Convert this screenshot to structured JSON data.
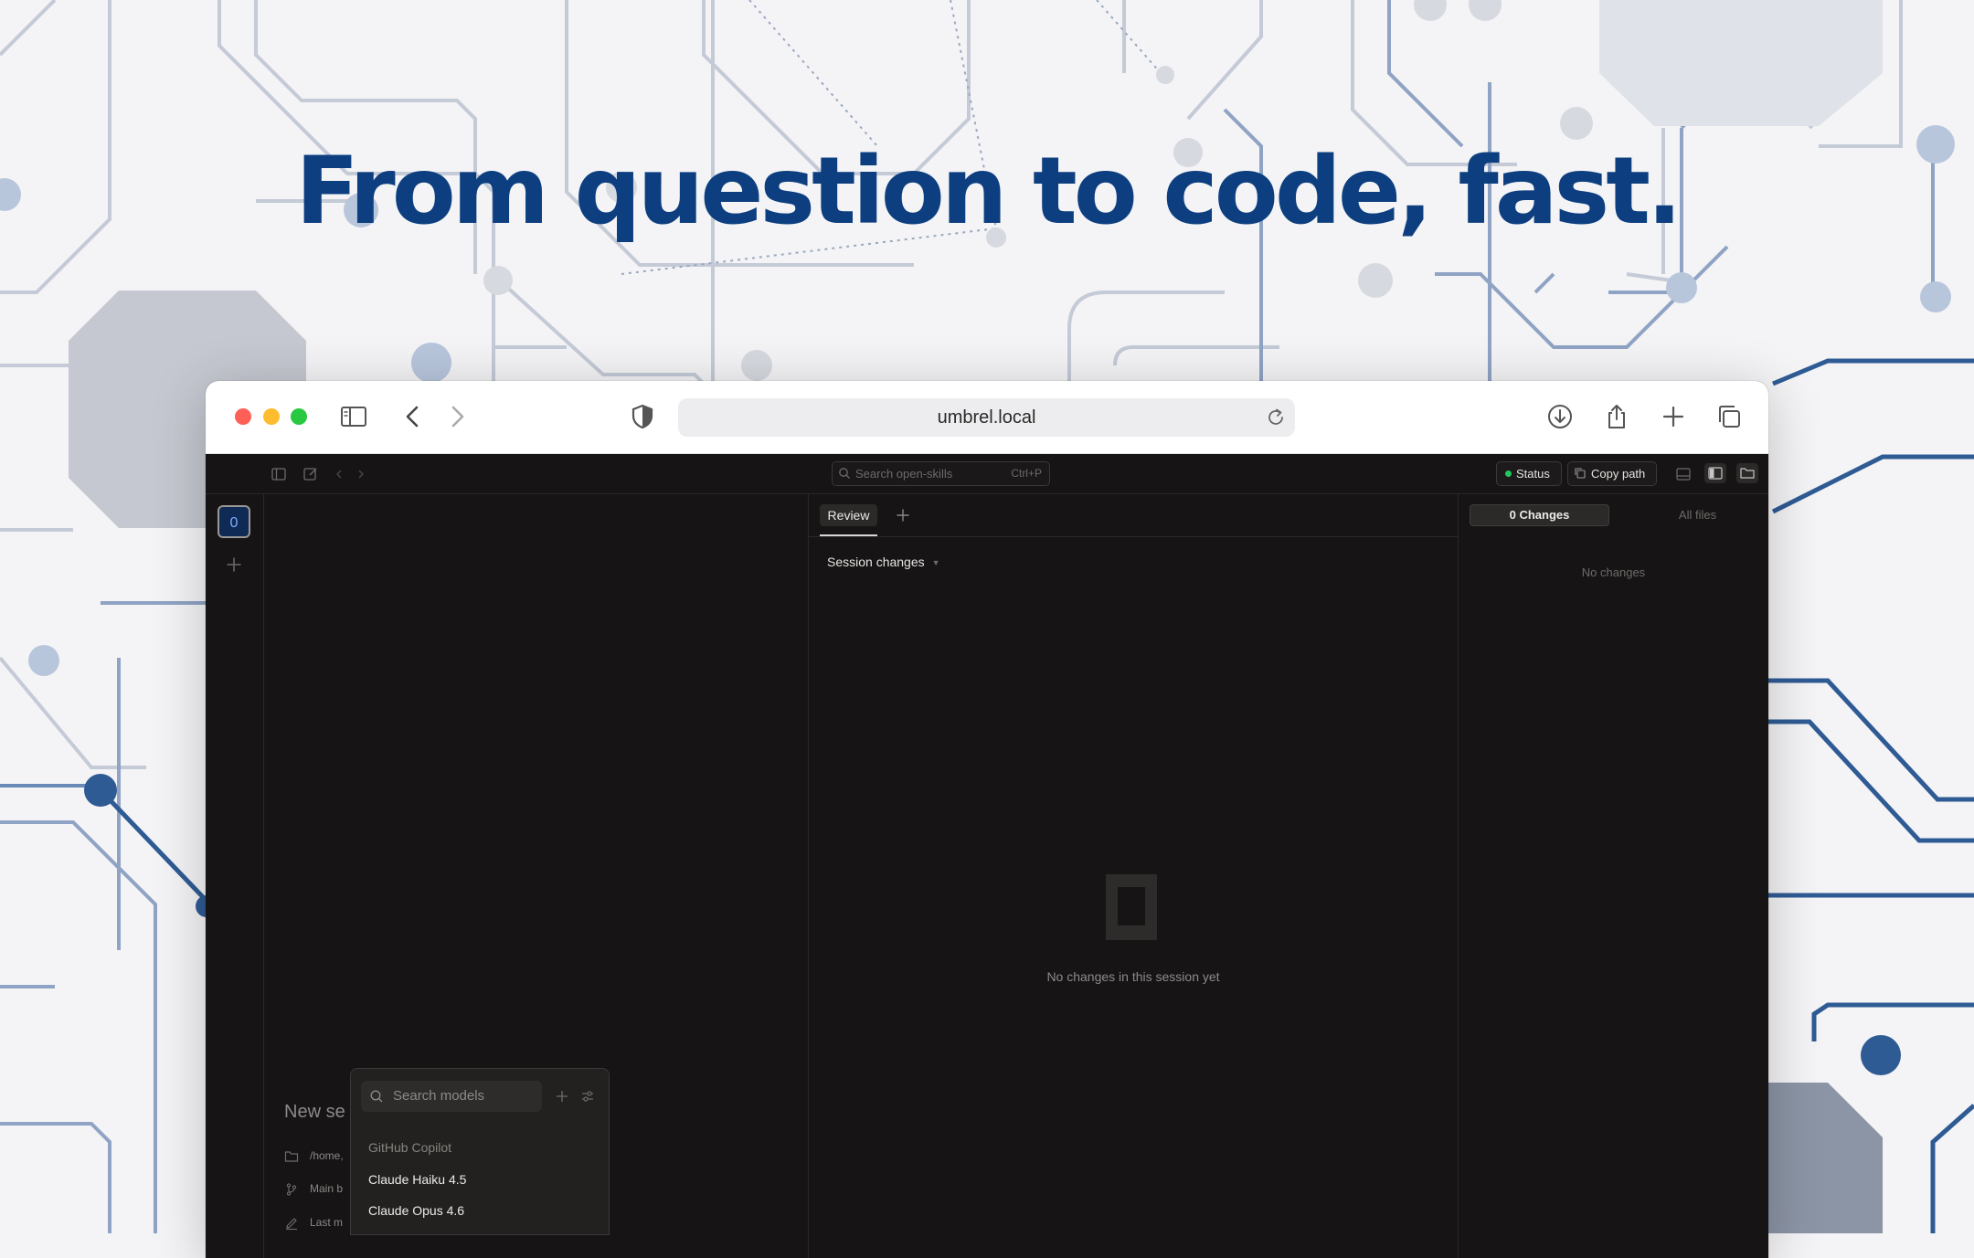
{
  "hero": {
    "headline": "From question to code, fast."
  },
  "browser": {
    "url": "umbrel.local"
  },
  "app": {
    "search": {
      "placeholder": "Search open-skills",
      "shortcut": "Ctrl+P"
    },
    "status_label": "Status",
    "status_color": "#22c55e",
    "copy_path_label": "Copy path",
    "workspace_badge": "0",
    "left": {
      "new_session": "New se",
      "meta": [
        "/home,",
        "Main b",
        "Last m"
      ]
    },
    "model_picker": {
      "placeholder": "Search models",
      "group": "GitHub Copilot",
      "options": [
        "Claude Haiku 4.5",
        "Claude Opus 4.6"
      ]
    },
    "center": {
      "tab_label": "Review",
      "session_changes": "Session changes",
      "empty_text": "No changes in this session yet"
    },
    "right": {
      "changes_tab": "0 Changes",
      "all_files_tab": "All files",
      "no_changes": "No changes"
    }
  },
  "colors": {
    "headline": "#0d3f80",
    "accent_blue": "#3b6cb0"
  }
}
